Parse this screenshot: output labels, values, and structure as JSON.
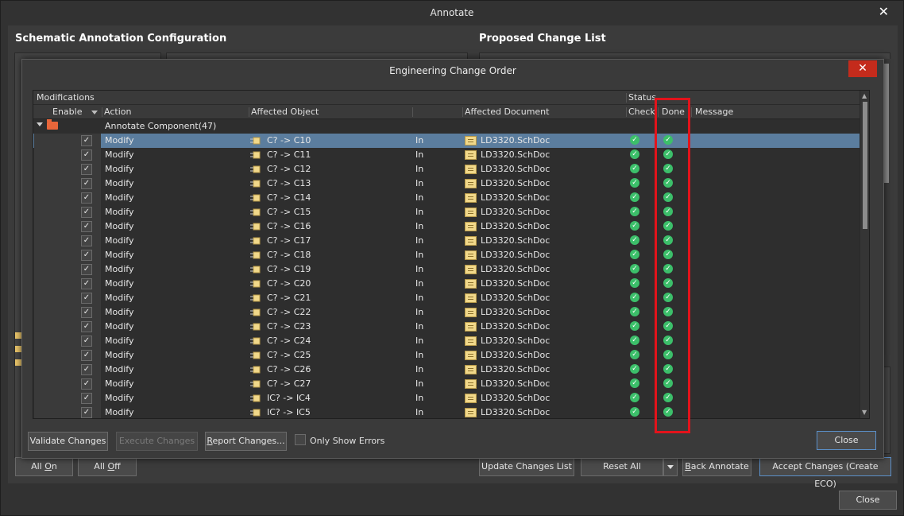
{
  "outer": {
    "title": "Annotate",
    "close_glyph": "✕",
    "left_section_title": "Schematic Annotation Configuration",
    "right_section_title": "Proposed Change List",
    "buttons": {
      "all_on_pre": "All ",
      "all_on_u": "O",
      "all_on_post": "n",
      "all_off_pre": "All ",
      "all_off_u": "O",
      "all_off_post": "ff",
      "update_changes_list": "Update Changes List",
      "reset_all": "Reset All",
      "back_annotate_u": "B",
      "back_annotate_post": "ack Annotate",
      "accept_changes": "Accept Changes (Create ECO)",
      "close": "Close"
    }
  },
  "eco": {
    "title": "Engineering Change Order",
    "close_glyph": "✕",
    "group_headers": {
      "modifications": "Modifications",
      "status": "Status"
    },
    "columns": {
      "enable": "Enable",
      "action": "Action",
      "affected_object": "Affected Object",
      "affected_document": "Affected Document",
      "check": "Check",
      "done": "Done",
      "message": "Message"
    },
    "group_row": {
      "label": "Annotate Component(47)"
    },
    "rows": [
      {
        "action": "Modify",
        "object": "C? -> C10",
        "dir": "In",
        "doc": "LD3320.SchDoc",
        "selected": true
      },
      {
        "action": "Modify",
        "object": "C? -> C11",
        "dir": "In",
        "doc": "LD3320.SchDoc"
      },
      {
        "action": "Modify",
        "object": "C? -> C12",
        "dir": "In",
        "doc": "LD3320.SchDoc"
      },
      {
        "action": "Modify",
        "object": "C? -> C13",
        "dir": "In",
        "doc": "LD3320.SchDoc"
      },
      {
        "action": "Modify",
        "object": "C? -> C14",
        "dir": "In",
        "doc": "LD3320.SchDoc"
      },
      {
        "action": "Modify",
        "object": "C? -> C15",
        "dir": "In",
        "doc": "LD3320.SchDoc"
      },
      {
        "action": "Modify",
        "object": "C? -> C16",
        "dir": "In",
        "doc": "LD3320.SchDoc"
      },
      {
        "action": "Modify",
        "object": "C? -> C17",
        "dir": "In",
        "doc": "LD3320.SchDoc"
      },
      {
        "action": "Modify",
        "object": "C? -> C18",
        "dir": "In",
        "doc": "LD3320.SchDoc"
      },
      {
        "action": "Modify",
        "object": "C? -> C19",
        "dir": "In",
        "doc": "LD3320.SchDoc"
      },
      {
        "action": "Modify",
        "object": "C? -> C20",
        "dir": "In",
        "doc": "LD3320.SchDoc"
      },
      {
        "action": "Modify",
        "object": "C? -> C21",
        "dir": "In",
        "doc": "LD3320.SchDoc"
      },
      {
        "action": "Modify",
        "object": "C? -> C22",
        "dir": "In",
        "doc": "LD3320.SchDoc"
      },
      {
        "action": "Modify",
        "object": "C? -> C23",
        "dir": "In",
        "doc": "LD3320.SchDoc"
      },
      {
        "action": "Modify",
        "object": "C? -> C24",
        "dir": "In",
        "doc": "LD3320.SchDoc"
      },
      {
        "action": "Modify",
        "object": "C? -> C25",
        "dir": "In",
        "doc": "LD3320.SchDoc"
      },
      {
        "action": "Modify",
        "object": "C? -> C26",
        "dir": "In",
        "doc": "LD3320.SchDoc"
      },
      {
        "action": "Modify",
        "object": "C? -> C27",
        "dir": "In",
        "doc": "LD3320.SchDoc"
      },
      {
        "action": "Modify",
        "object": "IC? -> IC4",
        "dir": "In",
        "doc": "LD3320.SchDoc"
      },
      {
        "action": "Modify",
        "object": "IC? -> IC5",
        "dir": "In",
        "doc": "LD3320.SchDoc"
      }
    ],
    "buttons": {
      "validate": "Validate Changes",
      "execute": "Execute Changes",
      "report_u": "R",
      "report_post": "eport Changes...",
      "only_show_errors": "Only Show Errors",
      "close": "Close"
    },
    "check_glyph": "✓",
    "ok_glyph": "✓"
  },
  "colors": {
    "selected_row": "#5b7d9e",
    "status_ok": "#3cbf6a",
    "highlight_box": "#e3131b",
    "close_red": "#c42b1c"
  },
  "icons": {
    "component": "component-icon",
    "document": "schdoc-icon",
    "folder": "folder-icon"
  }
}
